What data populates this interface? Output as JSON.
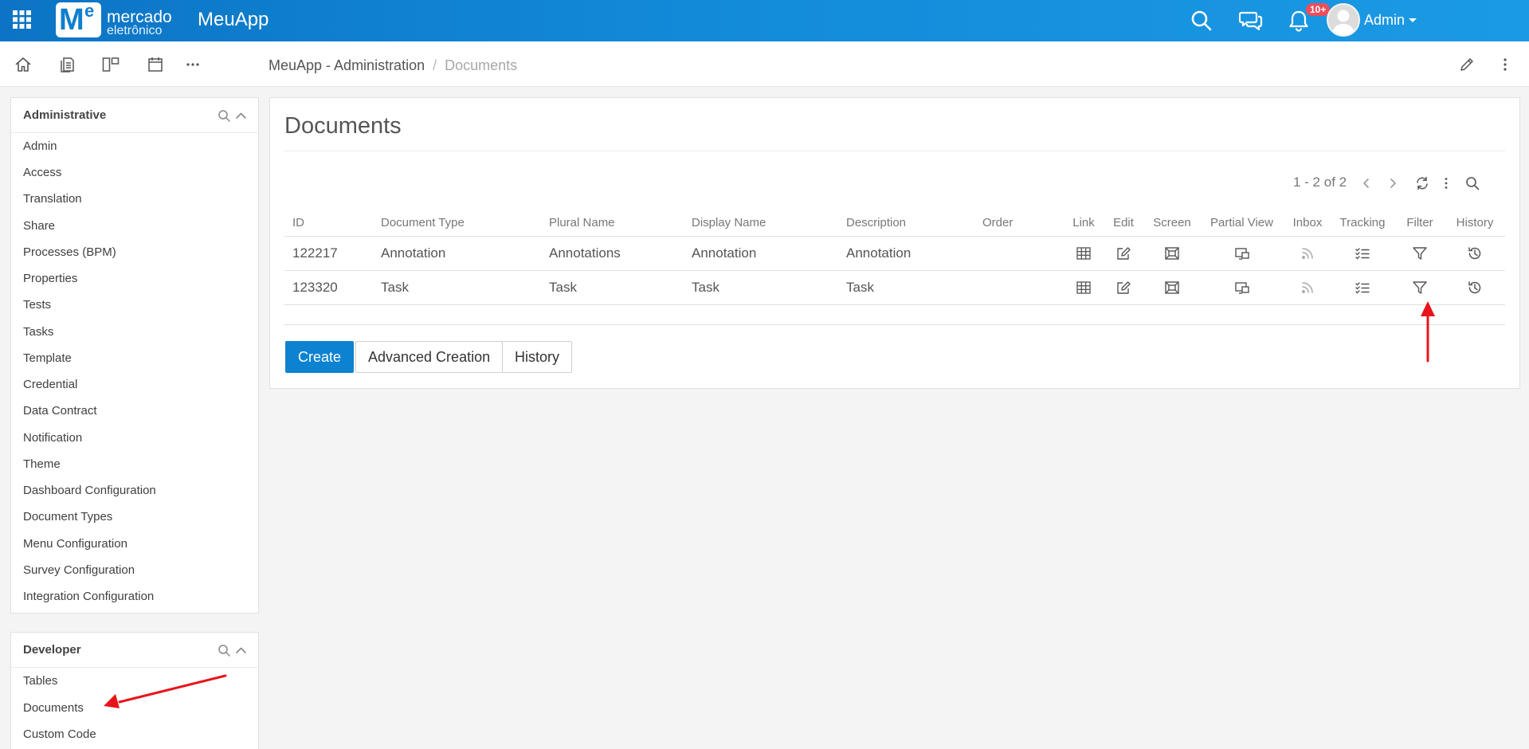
{
  "topbar": {
    "logo_line1": "mercado",
    "logo_line2": "eletrônico",
    "logo_letter": "M",
    "logo_super": "e",
    "app_name": "MeuApp",
    "notifications_badge": "10+",
    "user_name": "Admin",
    "icons": [
      "apps-grid-icon",
      "search-icon",
      "chat-icon",
      "bell-icon",
      "avatar"
    ]
  },
  "subbar": {
    "breadcrumb": {
      "parent": "MeuApp - Administration",
      "separator": "/",
      "current": "Documents"
    },
    "icons": [
      "home-icon",
      "documents-icon",
      "layout-icon",
      "calendar-icon",
      "more-icon",
      "edit-icon",
      "kebab-icon"
    ]
  },
  "sidebar": {
    "administrative": {
      "title": "Administrative",
      "items": [
        "Admin",
        "Access",
        "Translation",
        "Share",
        "Processes (BPM)",
        "Properties",
        "Tests",
        "Tasks",
        "Template",
        "Credential",
        "Data Contract",
        "Notification",
        "Theme",
        "Dashboard Configuration",
        "Document Types",
        "Menu Configuration",
        "Survey Configuration",
        "Integration Configuration"
      ]
    },
    "developer": {
      "title": "Developer",
      "items": [
        "Tables",
        "Documents",
        "Custom Code"
      ]
    }
  },
  "main": {
    "title": "Documents",
    "pager": "1 - 2 of 2",
    "table": {
      "text_columns": [
        "ID",
        "Document Type",
        "Plural Name",
        "Display Name",
        "Description",
        "Order"
      ],
      "icon_columns": [
        "Link",
        "Edit",
        "Screen",
        "Partial View",
        "Inbox",
        "Tracking",
        "Filter",
        "History"
      ],
      "rows": [
        {
          "id": "122217",
          "document_type": "Annotation",
          "plural_name": "Annotations",
          "display_name": "Annotation",
          "description": "Annotation",
          "order": ""
        },
        {
          "id": "123320",
          "document_type": "Task",
          "plural_name": "Task",
          "display_name": "Task",
          "description": "Task",
          "order": ""
        }
      ]
    },
    "buttons": {
      "create": "Create",
      "advanced_creation": "Advanced Creation",
      "history": "History"
    }
  },
  "colors": {
    "topbar": "#128ad8",
    "primary_button": "#0c82d0",
    "badge": "#ee4d5a",
    "annotation_arrow": "#e8141b"
  }
}
